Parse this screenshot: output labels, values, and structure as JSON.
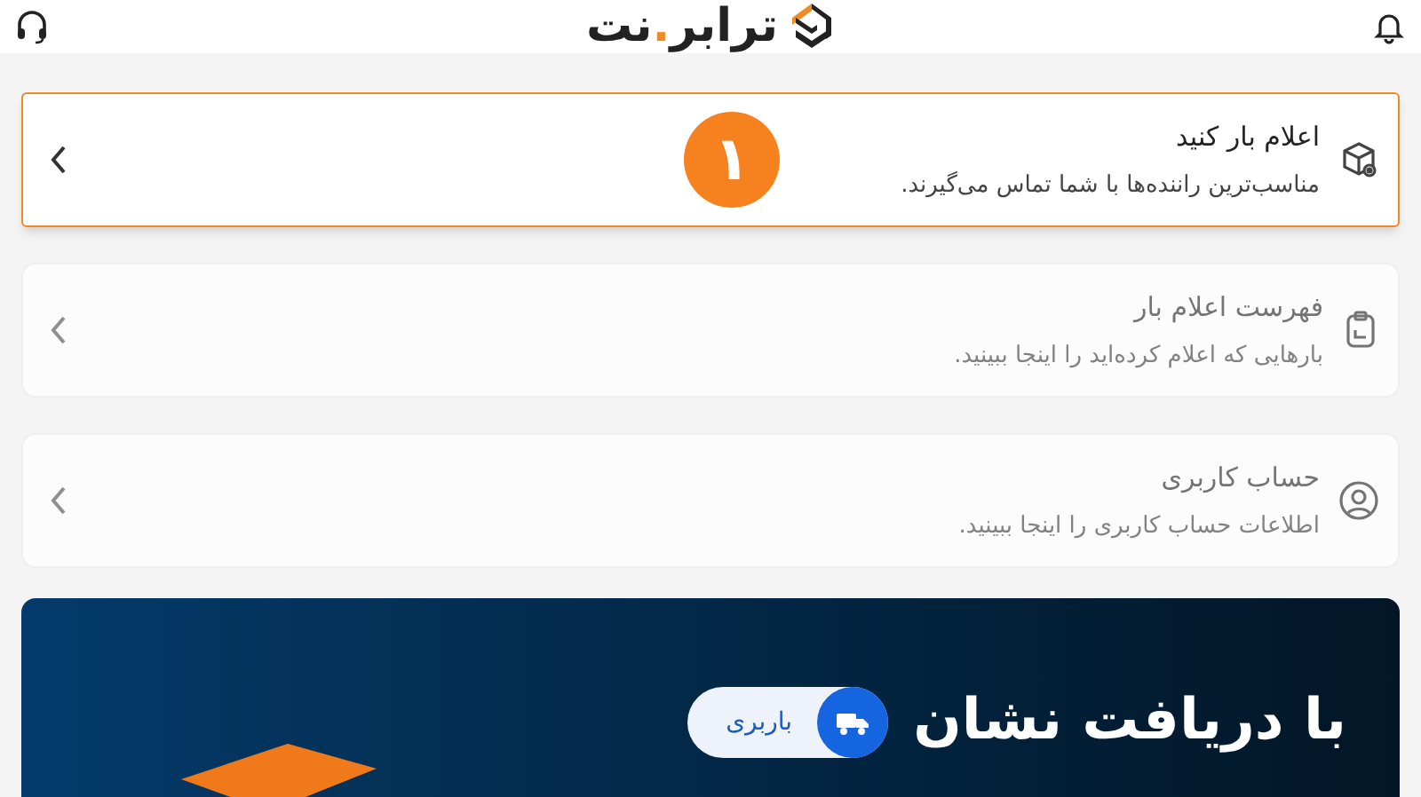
{
  "header": {
    "logo": {
      "text_before": "ترابر",
      "dot": ".",
      "text_after": "نت"
    }
  },
  "menu_items": [
    {
      "kind": "box",
      "title": "اعلام بار کنید",
      "subtitle": "مناسب‌ترین راننده‌ها با شما تماس می‌گیرند.",
      "selected": true,
      "step_badge": "۱"
    },
    {
      "kind": "clipboard",
      "title": "فهرست اعلام بار",
      "subtitle": "بارهایی که اعلام کرده‌اید را اینجا ببینید.",
      "selected": false
    },
    {
      "kind": "user",
      "title": "حساب کاربری",
      "subtitle": "اطلاعات حساب کاربری را اینجا ببینید.",
      "selected": false
    }
  ],
  "banner": {
    "headline": "با دریافت نشان",
    "pill": "باربری"
  }
}
